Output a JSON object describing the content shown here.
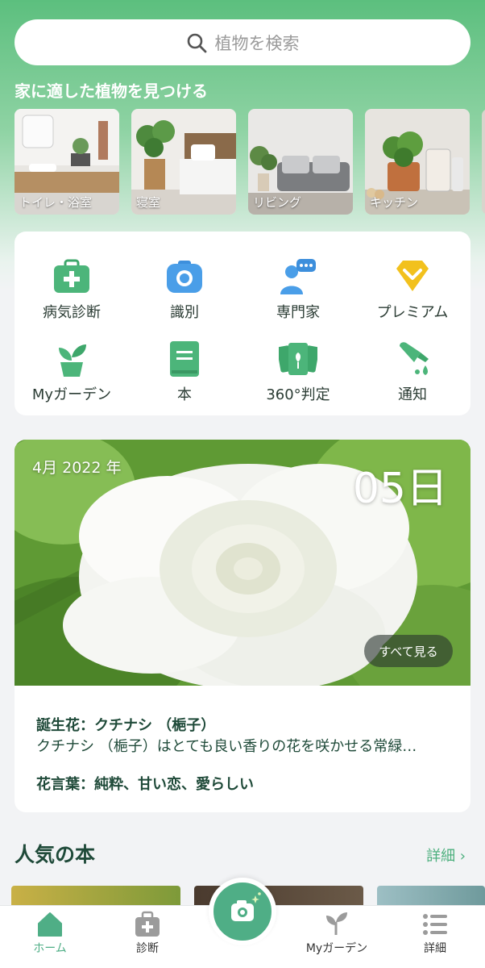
{
  "search": {
    "placeholder": "植物を検索",
    "icon": "search-icon"
  },
  "rooms_section": {
    "title": "家に適した植物を見つける",
    "rooms": [
      {
        "label": "トイレ・浴室"
      },
      {
        "label": "寝室"
      },
      {
        "label": "リビング"
      },
      {
        "label": "キッチン"
      }
    ]
  },
  "features": [
    {
      "label": "病気診断",
      "icon": "first-aid-kit-icon",
      "color": "#4cb57a"
    },
    {
      "label": "識別",
      "icon": "camera-icon",
      "color": "#4a9ee8"
    },
    {
      "label": "専門家",
      "icon": "expert-chat-icon",
      "color": "#4a9ee8"
    },
    {
      "label": "プレミアム",
      "icon": "premium-diamond-icon",
      "color": "#f0c020"
    },
    {
      "label": "Myガーデン",
      "icon": "potted-plant-icon",
      "color": "#4cb57a"
    },
    {
      "label": "本",
      "icon": "book-icon",
      "color": "#4cb57a"
    },
    {
      "label": "360°判定",
      "icon": "cards-icon",
      "color": "#4cb57a"
    },
    {
      "label": "通知",
      "icon": "watering-can-icon",
      "color": "#4cb57a"
    }
  ],
  "flower_of_day": {
    "month_year": "4月 2022 年",
    "day": "05日",
    "see_all": "すべて見る",
    "birth_flower_title": "誕生花：クチナシ （梔子）",
    "birth_flower_desc": "クチナシ （梔子）はとても良い香りの花を咲かせる常緑…",
    "flower_language": "花言葉：純粋、甘い恋、愛らしい"
  },
  "popular_books": {
    "title": "人気の本",
    "more": "詳細 ›"
  },
  "tabbar": {
    "items": [
      {
        "label": "ホーム",
        "icon": "home-icon",
        "active": true
      },
      {
        "label": "診断",
        "icon": "first-aid-kit-icon",
        "active": false
      },
      {
        "label": "Myガーデン",
        "icon": "sprout-icon",
        "active": false
      },
      {
        "label": "詳細",
        "icon": "list-icon",
        "active": false
      }
    ],
    "center_icon": "camera-icon"
  },
  "colors": {
    "accent": "#4fae86",
    "text_dark": "#1f4a39"
  }
}
